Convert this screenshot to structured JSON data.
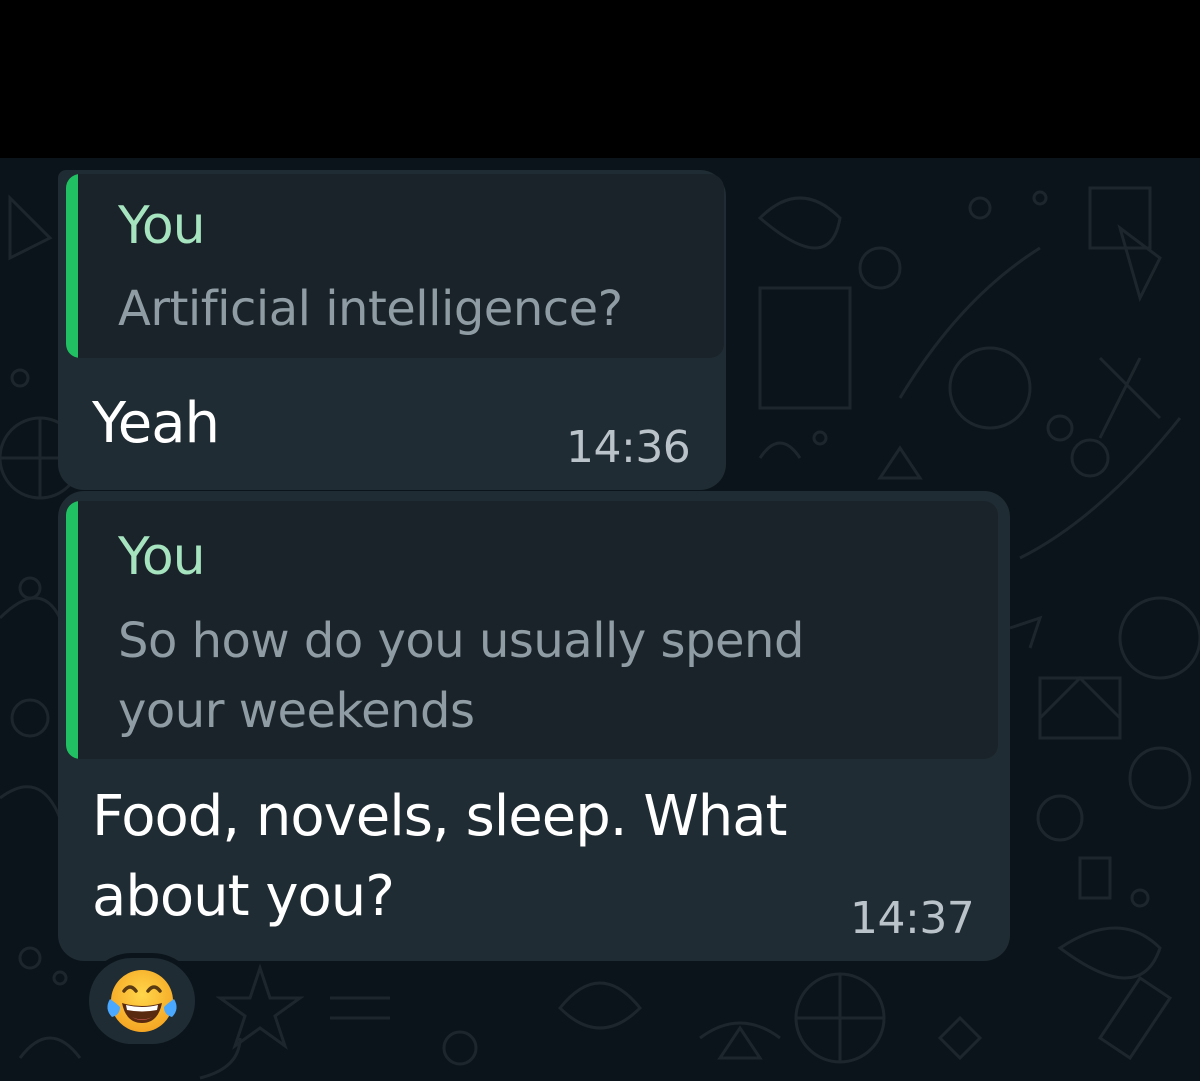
{
  "messages": [
    {
      "quote": {
        "author": "You",
        "text": "Artificial intelligence?"
      },
      "text": "Yeah",
      "time": "14:36"
    },
    {
      "quote": {
        "author": "You",
        "text_line1": "So how do you usually spend",
        "text_line2": "your weekends"
      },
      "text_line1": "Food, novels, sleep. What",
      "text_line2": "about you?",
      "time": "14:37",
      "reaction": "tears-of-joy-emoji"
    }
  ],
  "colors": {
    "top_bar": "#000000",
    "chat_background": "#0b141a",
    "bubble": "#202c33",
    "quote_background": "#1a2329",
    "quote_accent": "#21c063",
    "quote_author": "#a6e3bf",
    "quote_text": "#8f9ca3",
    "message_text": "#ffffff",
    "timestamp": "#b9c3c9"
  }
}
